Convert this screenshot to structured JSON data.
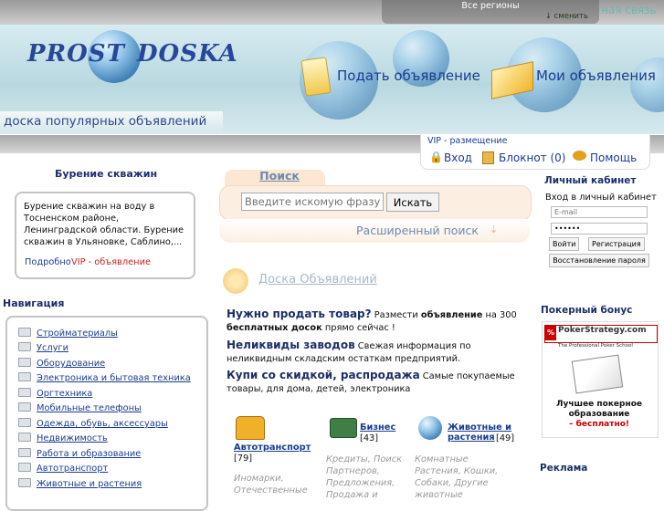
{
  "top": {
    "region": "Все регионы",
    "change_region": "↓ сменить",
    "feedback": "ная связь"
  },
  "logo": {
    "left": "PROST",
    "right": "DOSKA",
    "slogan": "доска популярных объявлений"
  },
  "header_links": {
    "post_ad": "Подать объявление",
    "my_ads": "Мои объявления"
  },
  "userbar": {
    "vip": "VIP - размещение",
    "login": "Вход",
    "notebook": "Блокнот (0)",
    "help": "Помощь"
  },
  "promo": {
    "title": "Бурение скважин",
    "text": "Бурение скважин на воду в Тосненском районе, Ленинградской области. Бурение скважин в Ульяновке, Саблино,...",
    "more": "Подробно",
    "vip": "VIP - объявление"
  },
  "nav": {
    "title": "Навигация",
    "items": [
      "Стройматериалы",
      "Услуги",
      "Оборудование",
      "Электроника и бытовая техника",
      "Оргтехника",
      "Мобильные телефоны",
      "Одежда, обувь, аксессуары",
      "Недвижимость",
      "Работа и образование",
      "Автотранспорт",
      "Животные и растения"
    ]
  },
  "search": {
    "tab": "Поиск",
    "placeholder": "Введите искомую фразу",
    "button": "Искать",
    "advanced": "Расширенный поиск"
  },
  "board": {
    "title": "Доска Объявлений"
  },
  "pitches": [
    {
      "link": "Нужно продать товар?",
      "t1": " Размести ",
      "b1": "объявление",
      "t2": " на 300 ",
      "b2": "бесплатных досок",
      "t3": " прямо сейчас !"
    },
    {
      "link": "Неликвиды заводов",
      "t1": " Свежая информация по неликвидным складским остаткам предприятий.",
      "b1": "",
      "t2": "",
      "b2": "",
      "t3": ""
    },
    {
      "link": "Купи со скидкой, распродажа",
      "t1": " Самые покупаемые товары, для дома, детей, электроника",
      "b1": "",
      "t2": "",
      "b2": "",
      "t3": ""
    }
  ],
  "categories": [
    {
      "title": "Автотранспорт",
      "count": "[79]",
      "sub": "Иномарки, Отечественные"
    },
    {
      "title": "Бизнес",
      "count": "[43]",
      "sub": "Кредиты, Поиск Партнеров, Предложения, Продажа и"
    },
    {
      "title": "Животные и растения",
      "count": "[49]",
      "sub": "Комнатные Растения, Кошки, Собаки, Другие животные"
    }
  ],
  "cabinet": {
    "title": "Личный кабинет",
    "subtitle": "Вход в личный кабинет",
    "email_placeholder": "E-mail",
    "password_mask": "••••••",
    "login_btn": "Войти",
    "register_btn": "Регистрация",
    "restore_btn": "Восстановление пароля"
  },
  "poker": {
    "title": "Покерный бонус",
    "brand": "PokerStrategy.com",
    "tagline": "The Professional Poker School",
    "l1": "Лучшее покерное образование",
    "l2": "– бесплатно!"
  },
  "ads_title": "Реклама"
}
